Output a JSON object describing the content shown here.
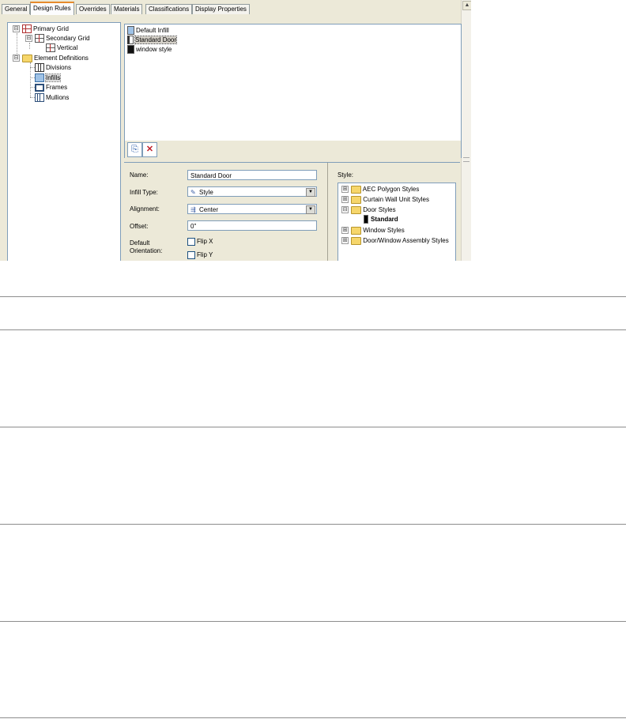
{
  "tabs": [
    "General",
    "Design Rules",
    "Overrides",
    "Materials",
    "Classifications",
    "Display Properties"
  ],
  "active_tab": "Design Rules",
  "left_tree": {
    "items": [
      {
        "label": "Primary Grid",
        "icon": "primary-grid-icon",
        "expander": "⊟"
      },
      {
        "label": "Secondary Grid",
        "icon": "secondary-grid-icon",
        "expander": "⊟"
      },
      {
        "label": "Vertical",
        "icon": "vertical-grid-icon",
        "expander": ""
      },
      {
        "label": "Element Definitions",
        "icon": "folder-icon",
        "expander": "⊟"
      },
      {
        "label": "Divisions",
        "icon": "divisions-icon",
        "expander": ""
      },
      {
        "label": "Infills",
        "icon": "infill-icon",
        "expander": ""
      },
      {
        "label": "Frames",
        "icon": "frames-icon",
        "expander": ""
      },
      {
        "label": "Mullions",
        "icon": "mullions-icon",
        "expander": ""
      }
    ],
    "selected": "Infills"
  },
  "infill_list": {
    "items": [
      {
        "label": "Default Infill",
        "swatch": "#9fc2e6"
      },
      {
        "label": "Standard Door",
        "swatch": "#ffffff"
      },
      {
        "label": "window style",
        "swatch": "#111111"
      }
    ],
    "selected": "Standard Door"
  },
  "toolbar": {
    "new_icon": "new-infill-icon",
    "delete_icon": "delete-infill-icon"
  },
  "properties": {
    "name_label": "Name:",
    "name_value": "Standard Door",
    "infill_type_label": "Infill Type:",
    "infill_type_value": "Style",
    "alignment_label": "Alignment:",
    "alignment_value": "Center",
    "offset_label": "Offset:",
    "offset_value": "0\"",
    "default_orientation_label_1": "Default",
    "default_orientation_label_2": "Orientation:",
    "flip_x_label": "Flip X",
    "flip_y_label": "Flip Y",
    "flip_x_checked": false,
    "flip_y_checked": false
  },
  "style_panel": {
    "label": "Style:",
    "items": [
      {
        "label": "AEC Polygon Styles",
        "expander": "⊞"
      },
      {
        "label": "Curtain Wall Unit Styles",
        "expander": "⊞"
      },
      {
        "label": "Door Styles",
        "expander": "⊟"
      },
      {
        "label": "Standard",
        "expander": ""
      },
      {
        "label": "Window Styles",
        "expander": "⊞"
      },
      {
        "label": "Door/Window Assembly Styles",
        "expander": "⊞"
      }
    ],
    "selected": "Standard"
  }
}
